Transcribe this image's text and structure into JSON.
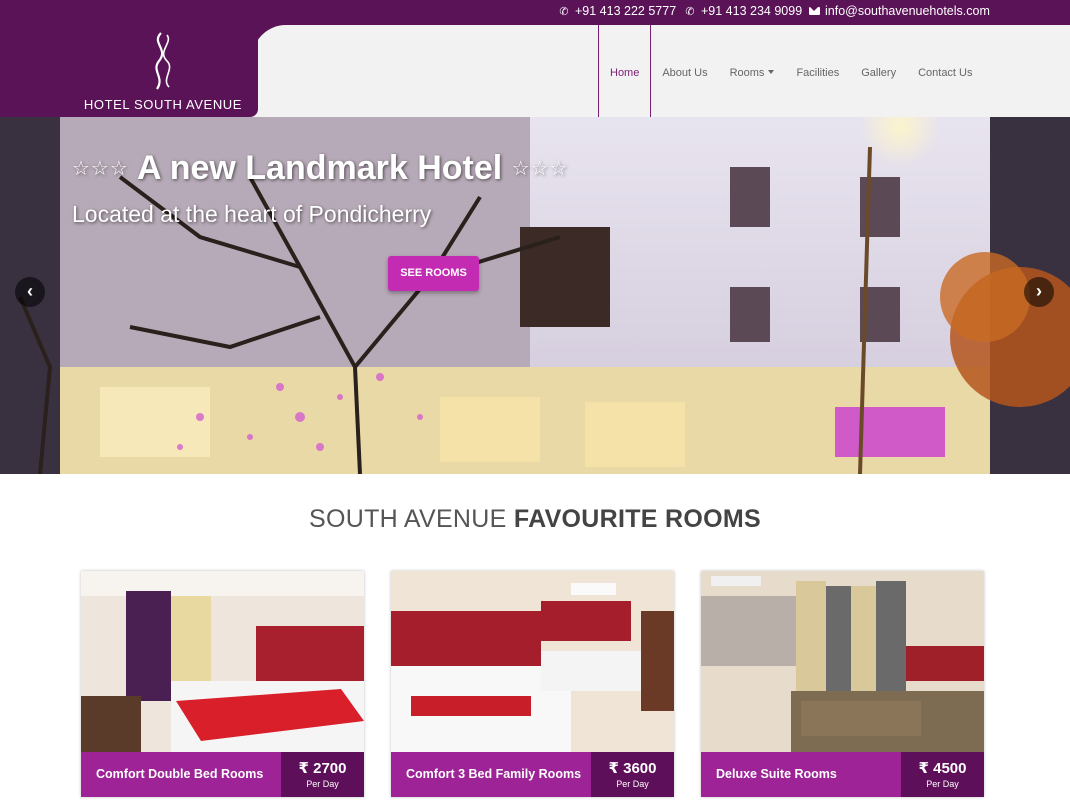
{
  "topbar": {
    "phone1": "+91 413 222 5777",
    "phone2": "+91 413 234 9099",
    "email": "info@southavenuehotels.com"
  },
  "brand": {
    "name": "HOTEL SOUTH AVENUE"
  },
  "nav": {
    "items": [
      {
        "label": "Home",
        "active": true
      },
      {
        "label": "About Us"
      },
      {
        "label": "Rooms"
      },
      {
        "label": "Facilities"
      },
      {
        "label": "Gallery"
      },
      {
        "label": "Contact Us"
      }
    ]
  },
  "hero": {
    "stars_left": "☆☆☆",
    "title": "A new Landmark Hotel",
    "stars_right": "☆☆☆",
    "subtitle": "Located at the heart of Pondicherry",
    "button": "SEE ROOMS",
    "prev_icon": "chevron-left-icon",
    "next_icon": "chevron-right-icon"
  },
  "section": {
    "title_light": "SOUTH AVENUE ",
    "title_bold": "FAVOURITE ROOMS"
  },
  "rooms": [
    {
      "name": "Comfort Double Bed Rooms",
      "price": "₹ 2700",
      "per": "Per Day"
    },
    {
      "name": "Comfort 3 Bed Family Rooms",
      "price": "₹ 3600",
      "per": "Per Day"
    },
    {
      "name": "Deluxe Suite Rooms",
      "price": "₹ 4500",
      "per": "Per Day"
    }
  ],
  "colors": {
    "brand": "#5b1357",
    "accent": "#9d2397",
    "button": "#c42bb3"
  }
}
